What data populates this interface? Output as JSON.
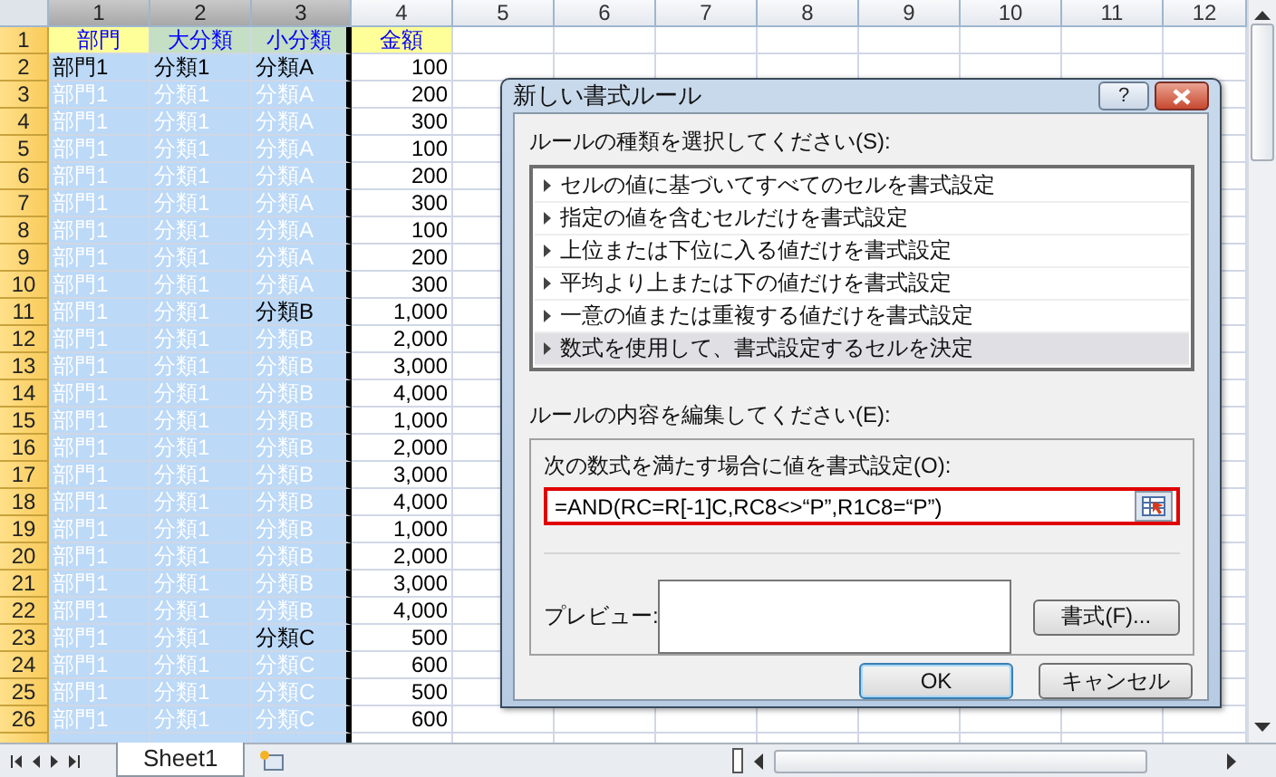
{
  "columns": [
    {
      "label": "1",
      "selected": true
    },
    {
      "label": "2",
      "selected": true
    },
    {
      "label": "3",
      "selected": true
    },
    {
      "label": "4",
      "selected": false
    },
    {
      "label": "5",
      "selected": false
    },
    {
      "label": "6",
      "selected": false
    },
    {
      "label": "7",
      "selected": false
    },
    {
      "label": "8",
      "selected": false
    },
    {
      "label": "9",
      "selected": false
    },
    {
      "label": "10",
      "selected": false
    },
    {
      "label": "11",
      "selected": false
    },
    {
      "label": "12",
      "selected": false
    }
  ],
  "header_row": {
    "number": "1",
    "selected": true,
    "cells": [
      {
        "text": "部門",
        "color": "#ffff99"
      },
      {
        "text": "大分類",
        "color": "#c4dfc4"
      },
      {
        "text": "小分類",
        "color": "#c4dfc4"
      },
      {
        "text": "金額",
        "color": "#ffff99"
      }
    ]
  },
  "rows": [
    {
      "number": "2",
      "selected": true,
      "cells": [
        {
          "text": "部門1",
          "faded": false
        },
        {
          "text": "分類1",
          "faded": false
        },
        {
          "text": "分類A",
          "faded": false
        }
      ],
      "amount": "100"
    },
    {
      "number": "3",
      "selected": true,
      "cells": [
        {
          "text": "部門1",
          "faded": true
        },
        {
          "text": "分類1",
          "faded": true
        },
        {
          "text": "分類A",
          "faded": true
        }
      ],
      "amount": "200"
    },
    {
      "number": "4",
      "selected": true,
      "cells": [
        {
          "text": "部門1",
          "faded": true
        },
        {
          "text": "分類1",
          "faded": true
        },
        {
          "text": "分類A",
          "faded": true
        }
      ],
      "amount": "300"
    },
    {
      "number": "5",
      "selected": true,
      "cells": [
        {
          "text": "部門1",
          "faded": true
        },
        {
          "text": "分類1",
          "faded": true
        },
        {
          "text": "分類A",
          "faded": true
        }
      ],
      "amount": "100"
    },
    {
      "number": "6",
      "selected": true,
      "cells": [
        {
          "text": "部門1",
          "faded": true
        },
        {
          "text": "分類1",
          "faded": true
        },
        {
          "text": "分類A",
          "faded": true
        }
      ],
      "amount": "200"
    },
    {
      "number": "7",
      "selected": true,
      "cells": [
        {
          "text": "部門1",
          "faded": true
        },
        {
          "text": "分類1",
          "faded": true
        },
        {
          "text": "分類A",
          "faded": true
        }
      ],
      "amount": "300"
    },
    {
      "number": "8",
      "selected": true,
      "cells": [
        {
          "text": "部門1",
          "faded": true
        },
        {
          "text": "分類1",
          "faded": true
        },
        {
          "text": "分類A",
          "faded": true
        }
      ],
      "amount": "100"
    },
    {
      "number": "9",
      "selected": true,
      "cells": [
        {
          "text": "部門1",
          "faded": true
        },
        {
          "text": "分類1",
          "faded": true
        },
        {
          "text": "分類A",
          "faded": true
        }
      ],
      "amount": "200"
    },
    {
      "number": "10",
      "selected": true,
      "cells": [
        {
          "text": "部門1",
          "faded": true
        },
        {
          "text": "分類1",
          "faded": true
        },
        {
          "text": "分類A",
          "faded": true
        }
      ],
      "amount": "300"
    },
    {
      "number": "11",
      "selected": true,
      "cells": [
        {
          "text": "部門1",
          "faded": true
        },
        {
          "text": "分類1",
          "faded": true
        },
        {
          "text": "分類B",
          "faded": false
        }
      ],
      "amount": "1,000"
    },
    {
      "number": "12",
      "selected": true,
      "cells": [
        {
          "text": "部門1",
          "faded": true
        },
        {
          "text": "分類1",
          "faded": true
        },
        {
          "text": "分類B",
          "faded": true
        }
      ],
      "amount": "2,000"
    },
    {
      "number": "13",
      "selected": true,
      "cells": [
        {
          "text": "部門1",
          "faded": true
        },
        {
          "text": "分類1",
          "faded": true
        },
        {
          "text": "分類B",
          "faded": true
        }
      ],
      "amount": "3,000"
    },
    {
      "number": "14",
      "selected": true,
      "cells": [
        {
          "text": "部門1",
          "faded": true
        },
        {
          "text": "分類1",
          "faded": true
        },
        {
          "text": "分類B",
          "faded": true
        }
      ],
      "amount": "4,000"
    },
    {
      "number": "15",
      "selected": true,
      "cells": [
        {
          "text": "部門1",
          "faded": true
        },
        {
          "text": "分類1",
          "faded": true
        },
        {
          "text": "分類B",
          "faded": true
        }
      ],
      "amount": "1,000"
    },
    {
      "number": "16",
      "selected": true,
      "cells": [
        {
          "text": "部門1",
          "faded": true
        },
        {
          "text": "分類1",
          "faded": true
        },
        {
          "text": "分類B",
          "faded": true
        }
      ],
      "amount": "2,000"
    },
    {
      "number": "17",
      "selected": true,
      "cells": [
        {
          "text": "部門1",
          "faded": true
        },
        {
          "text": "分類1",
          "faded": true
        },
        {
          "text": "分類B",
          "faded": true
        }
      ],
      "amount": "3,000"
    },
    {
      "number": "18",
      "selected": true,
      "cells": [
        {
          "text": "部門1",
          "faded": true
        },
        {
          "text": "分類1",
          "faded": true
        },
        {
          "text": "分類B",
          "faded": true
        }
      ],
      "amount": "4,000"
    },
    {
      "number": "19",
      "selected": true,
      "cells": [
        {
          "text": "部門1",
          "faded": true
        },
        {
          "text": "分類1",
          "faded": true
        },
        {
          "text": "分類B",
          "faded": true
        }
      ],
      "amount": "1,000"
    },
    {
      "number": "20",
      "selected": true,
      "cells": [
        {
          "text": "部門1",
          "faded": true
        },
        {
          "text": "分類1",
          "faded": true
        },
        {
          "text": "分類B",
          "faded": true
        }
      ],
      "amount": "2,000"
    },
    {
      "number": "21",
      "selected": true,
      "cells": [
        {
          "text": "部門1",
          "faded": true
        },
        {
          "text": "分類1",
          "faded": true
        },
        {
          "text": "分類B",
          "faded": true
        }
      ],
      "amount": "3,000"
    },
    {
      "number": "22",
      "selected": true,
      "cells": [
        {
          "text": "部門1",
          "faded": true
        },
        {
          "text": "分類1",
          "faded": true
        },
        {
          "text": "分類B",
          "faded": true
        }
      ],
      "amount": "4,000"
    },
    {
      "number": "23",
      "selected": true,
      "cells": [
        {
          "text": "部門1",
          "faded": true
        },
        {
          "text": "分類1",
          "faded": true
        },
        {
          "text": "分類C",
          "faded": false
        }
      ],
      "amount": "500"
    },
    {
      "number": "24",
      "selected": true,
      "cells": [
        {
          "text": "部門1",
          "faded": true
        },
        {
          "text": "分類1",
          "faded": true
        },
        {
          "text": "分類C",
          "faded": true
        }
      ],
      "amount": "600"
    },
    {
      "number": "25",
      "selected": true,
      "cells": [
        {
          "text": "部門1",
          "faded": true
        },
        {
          "text": "分類1",
          "faded": true
        },
        {
          "text": "分類C",
          "faded": true
        }
      ],
      "amount": "500"
    },
    {
      "number": "26",
      "selected": true,
      "cells": [
        {
          "text": "部門1",
          "faded": true
        },
        {
          "text": "分類1",
          "faded": true
        },
        {
          "text": "分類C",
          "faded": true
        }
      ],
      "amount": "600"
    }
  ],
  "sheet_tabs": [
    {
      "label": "Sheet1",
      "selected": true
    }
  ],
  "dialog": {
    "title": "新しい書式ルール",
    "help_button": "?",
    "rule_type_label": "ルールの種類を選択してください(S):",
    "rule_types": [
      {
        "label": "セルの値に基づいてすべてのセルを書式設定",
        "selected": false
      },
      {
        "label": "指定の値を含むセルだけを書式設定",
        "selected": false
      },
      {
        "label": "上位または下位に入る値だけを書式設定",
        "selected": false
      },
      {
        "label": "平均より上または下の値だけを書式設定",
        "selected": false
      },
      {
        "label": "一意の値または重複する値だけを書式設定",
        "selected": false
      },
      {
        "label": "数式を使用して、書式設定するセルを決定",
        "selected": true
      }
    ],
    "edit_label": "ルールの内容を編集してください(E):",
    "formula_label": "次の数式を満たす場合に値を書式設定(O):",
    "formula": "=AND(RC=R[-1]C,RC8<>“P”,R1C8=“P”)",
    "preview_label": "プレビュー:",
    "format_button": "書式(F)...",
    "ok_button": "OK",
    "cancel_button": "キャンセル"
  }
}
